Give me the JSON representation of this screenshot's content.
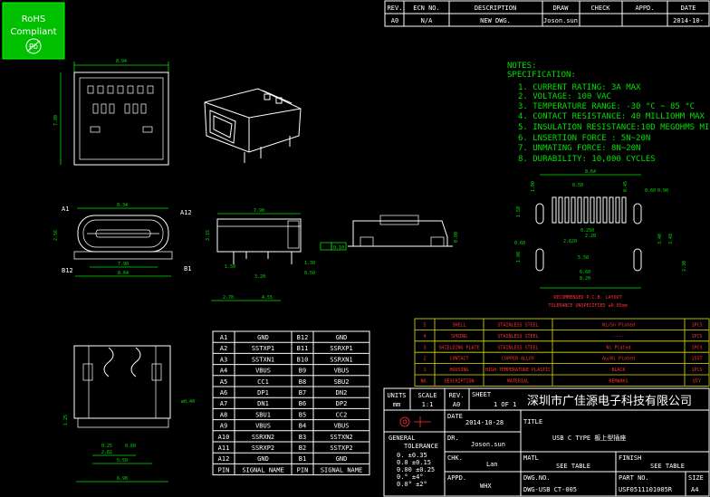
{
  "logo": {
    "line1": "RoHS",
    "line2": "Compliant",
    "mark": "Pb"
  },
  "revision": {
    "headers": [
      "REV.",
      "ECN NO.",
      "DESCRIPTION",
      "DRAW",
      "CHECK",
      "APPD.",
      "DATE"
    ],
    "row": [
      "A0",
      "N/A",
      "NEW DWG.",
      "Joson.sun",
      "",
      "",
      "2014-10-"
    ]
  },
  "notes": {
    "title1": "NOTES:",
    "title2": "SPECIFICATION:",
    "items": [
      "1. CURRENT RATING: 3A MAX",
      "2. VOLTAGE: 100 VAC",
      "3. TEMPERATURE RANGE: -30 °C ~ 85 °C",
      "4. CONTACT RESISTANCE: 40 MILLIOHM MAX",
      "5. INSULATION RESISTANCE:10D MEGOHMS MIN.",
      "6. LNSERTION FORCE : 5N~20N",
      "7. UNMATING FORCE: 8N~20N",
      "8. DURABILITY:    10,000 CYCLES"
    ]
  },
  "dims": {
    "top_width": "8.94",
    "top_height": "7.80",
    "front_width": "8.34",
    "front_left": "2.56",
    "front_bottom1": "7.90",
    "front_bottom2": "8.64",
    "pin_a1": "A1",
    "pin_a12": "A12",
    "pin_b12": "B12",
    "pin_b1": "B1",
    "side_top": "7.90",
    "side_h": "3.15",
    "side_150": "1.50",
    "side_320": "3.20",
    "side_130": "1.30",
    "side_050": "0.50",
    "side_270": "2.70",
    "side_455": "4.55",
    "flatness": "0.10",
    "rear_h": "0.80",
    "layout_top": "8.64",
    "layout_050": "0.50",
    "layout_0250": "0.250",
    "layout_060": "0.60",
    "layout_220": "2.20",
    "layout_2620": "2.620",
    "layout_550": "5.50",
    "layout_660": "6.60",
    "layout_820": "8.20",
    "layout_045": "0.45",
    "layout_100": "1.00",
    "layout_090": "0.90",
    "layout_180": "1.80",
    "layout_340": "3.40",
    "layout_348": "3.48",
    "layout_230": "2.30",
    "layout_150": "1.50",
    "layout_060b": "0.60",
    "layout_title": "RECOMMENDED P.C.B. LAYOUT",
    "layout_tol": "TOLERANCE UNSPECIFIED ±0.05mm",
    "bottom_640": "ø0.40",
    "bottom_125": "1.25",
    "bottom_025": "0.25",
    "bottom_060": "0.60",
    "bottom_282": "2.82",
    "bottom_550": "5.50",
    "bottom_690": "6.90"
  },
  "pin_table": {
    "rows": [
      [
        "A1",
        "GND",
        "B12",
        "GND"
      ],
      [
        "A2",
        "SSTXP1",
        "B11",
        "SSRXP1"
      ],
      [
        "A3",
        "SSTXN1",
        "B10",
        "SSRXN1"
      ],
      [
        "A4",
        "VBUS",
        "B9",
        "VBUS"
      ],
      [
        "A5",
        "CC1",
        "B8",
        "SBU2"
      ],
      [
        "A6",
        "DP1",
        "B7",
        "DN2"
      ],
      [
        "A7",
        "DN1",
        "B6",
        "DP2"
      ],
      [
        "A8",
        "SBU1",
        "B5",
        "CC2"
      ],
      [
        "A9",
        "VBUS",
        "B4",
        "VBUS"
      ],
      [
        "A10",
        "SSRXN2",
        "B3",
        "SSTXN2"
      ],
      [
        "A11",
        "SSRXP2",
        "B2",
        "SSTXP2"
      ],
      [
        "A12",
        "GND",
        "B1",
        "GND"
      ]
    ],
    "footer": [
      "PIN",
      "SIGNAL NAME",
      "PIN",
      "SIGNAL NAME"
    ]
  },
  "bom": {
    "rows": [
      [
        "5",
        "SHELL",
        "STAINLESS STEEL",
        "Ni/Sn Plated",
        "1PCS"
      ],
      [
        "4",
        "SPRING",
        "STAINLESS STEEL",
        "----",
        "1PCS"
      ],
      [
        "3",
        "SHIELDING PLATE",
        "STAINLESS STEEL",
        "Ni Plated",
        "1PCS"
      ],
      [
        "2",
        "CONTACT",
        "COPPER ALLOY",
        "Au/Ni Plated",
        "15ST"
      ],
      [
        "1",
        "HOUSING",
        "HIGH TEMPERATURE PLASTIC",
        "BLACK",
        "1PCS"
      ]
    ],
    "header": [
      "NO.",
      "DESCRIPTION",
      "MATERIAL",
      "REMARKS",
      "QTY"
    ]
  },
  "title_block": {
    "units_label": "UNITS",
    "units_value": "mm",
    "scale_label": "SCALE",
    "scale_value": "1:1",
    "rev_label": "REV.",
    "rev_value": "A0",
    "sheet_label": "SHEET",
    "sheet_value": "1 OF 1",
    "company": "深圳市广佳源电子科技有限公司",
    "date_label": "DATE",
    "date_value": "2014-10-28",
    "title_label": "TITLE",
    "title_value": "USB C TYPE 板上型插座",
    "general": "GENERAL",
    "tolerance": "TOLERANCE",
    "tol_values": [
      "0.  ±0.35",
      "0.0  ±0.15",
      "0.00 ±0.25",
      "0.°  ±4°",
      "0.0° ±2°"
    ],
    "dr_label": "DR.",
    "dr_value": "Joson.sun",
    "chk_label": "CHK.",
    "chk_value": "Lan",
    "matl_label": "MATL",
    "matl_value": "SEE TABLE",
    "finish_label": "FINISH",
    "finish_value": "SEE TABLE",
    "appd_label": "APPD.",
    "appd_value": "WHX",
    "dwgno_label": "DWG.NO.",
    "dwgno_value": "DWG-USB CT-005",
    "partno_label": "PART NO.",
    "partno_value": "USF0511101005R",
    "size_label": "SIZE",
    "size_value": "A4"
  }
}
